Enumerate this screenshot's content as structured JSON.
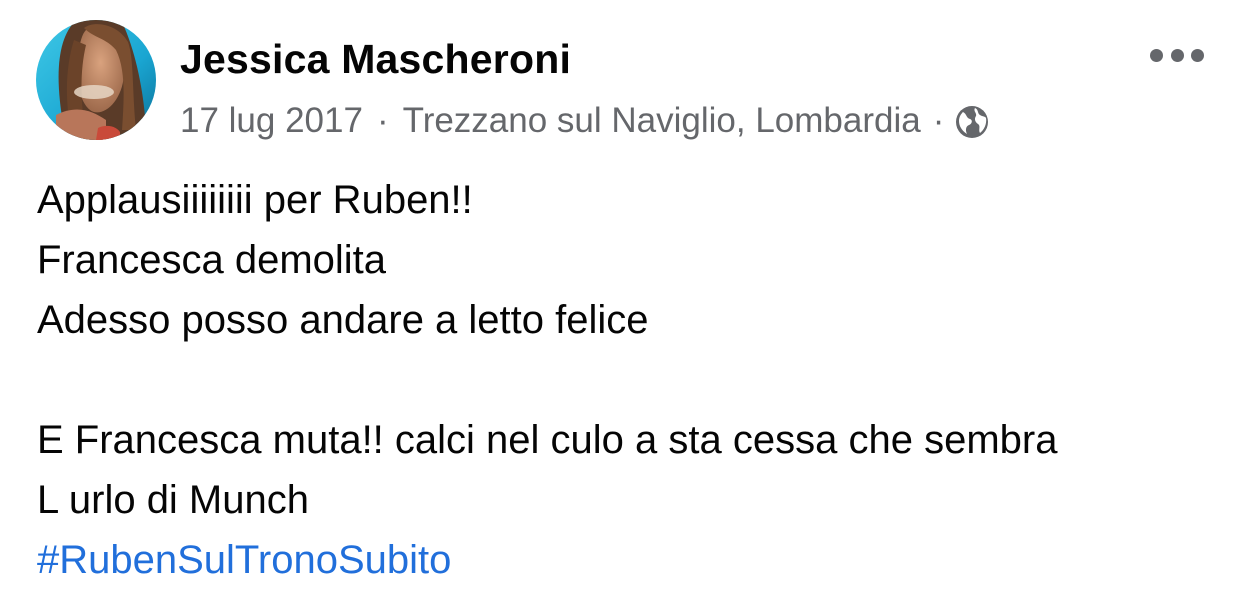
{
  "post": {
    "author": "Jessica Mascheroni",
    "date": "17 lug 2017",
    "separator": "·",
    "location": "Trezzano sul Naviglio, Lombardia",
    "privacy_icon": "globe-icon",
    "more_icon": "more-options-icon",
    "lines": [
      "Applausiiiiiiii per Ruben!!",
      "Francesca demolita",
      "Adesso posso andare a letto felice",
      "",
      "E Francesca muta!! calci nel culo a sta cessa che sembra",
      "L urlo di Munch"
    ],
    "hashtag": "#RubenSulTronoSubito"
  },
  "colors": {
    "text": "#050505",
    "secondary": "#65676b",
    "link": "#216fdb",
    "background": "#ffffff"
  }
}
